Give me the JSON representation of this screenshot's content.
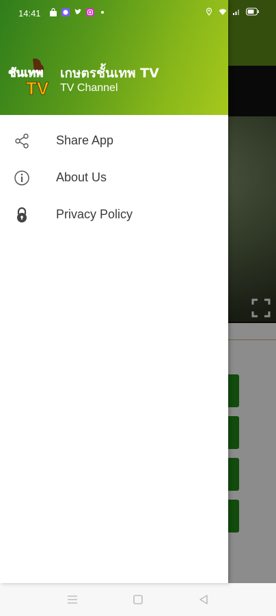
{
  "status_bar": {
    "time": "14:41",
    "left_icons": [
      "bag-icon",
      "messenger-icon",
      "twitter-icon",
      "instagram-icon",
      "dot-icon"
    ],
    "right_icons": [
      "location-icon",
      "wifi-icon",
      "signal-icon",
      "battery-icon"
    ]
  },
  "drawer": {
    "header": {
      "logo_text": "ชันเทพ TV",
      "title": "เกษตรชั้นเทพ TV",
      "subtitle": "TV Channel"
    },
    "menu": [
      {
        "label": "Share App",
        "icon": "share-icon"
      },
      {
        "label": "About Us",
        "icon": "info-icon"
      },
      {
        "label": "Privacy Policy",
        "icon": "lock-icon"
      }
    ]
  },
  "nav_bar": {
    "buttons": [
      "menu-icon",
      "home-square-icon",
      "back-triangle-icon"
    ]
  },
  "colors": {
    "header_gradient_start": "#2f7d1b",
    "header_gradient_end": "#a6c81d",
    "bg_button_green": "#1f8a18",
    "menu_text": "#3a3a3a"
  }
}
